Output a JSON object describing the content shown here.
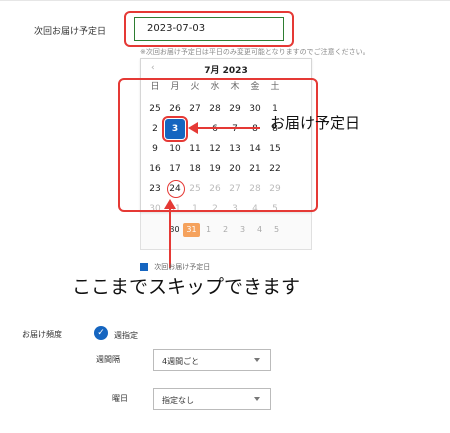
{
  "form": {
    "next_delivery_label": "次回お届け予定日",
    "date_value": "2023-07-03",
    "note": "※次回お届け予定日は平日のみ変更可能となりますのでご注意ください。",
    "frequency_label": "お届け頻度",
    "frequency_option": "週指定",
    "interval_label": "週間隔",
    "interval_value": "4週間ごと",
    "weekday_label": "曜日",
    "weekday_value": "指定なし",
    "hidden_checkbox_label": "次回お届け予定日"
  },
  "calendar": {
    "month_title": "7月 2023",
    "prev_icon": "‹",
    "weekdays": [
      "日",
      "月",
      "火",
      "水",
      "木",
      "金",
      "土"
    ],
    "rows": [
      [
        {
          "d": "25",
          "dim": false
        },
        {
          "d": "26",
          "dim": false
        },
        {
          "d": "27",
          "dim": false
        },
        {
          "d": "28",
          "dim": false
        },
        {
          "d": "29",
          "dim": false
        },
        {
          "d": "30",
          "dim": false
        },
        {
          "d": "1",
          "dim": false
        }
      ],
      [
        {
          "d": "2",
          "dim": false
        },
        {
          "d": "3",
          "dim": false,
          "sel": true
        },
        {
          "d": "4",
          "dim": false
        },
        {
          "d": "6",
          "dim": false
        },
        {
          "d": "7",
          "dim": false
        },
        {
          "d": "8",
          "dim": false
        },
        {
          "d": "8",
          "dim": false
        }
      ],
      [
        {
          "d": "9",
          "dim": false
        },
        {
          "d": "10",
          "dim": false
        },
        {
          "d": "11",
          "dim": false
        },
        {
          "d": "12",
          "dim": false
        },
        {
          "d": "13",
          "dim": false
        },
        {
          "d": "14",
          "dim": false
        },
        {
          "d": "15",
          "dim": false
        }
      ],
      [
        {
          "d": "16",
          "dim": false
        },
        {
          "d": "17",
          "dim": false
        },
        {
          "d": "18",
          "dim": false
        },
        {
          "d": "19",
          "dim": false
        },
        {
          "d": "20",
          "dim": false
        },
        {
          "d": "21",
          "dim": false
        },
        {
          "d": "22",
          "dim": false
        }
      ],
      [
        {
          "d": "23",
          "dim": false
        },
        {
          "d": "24",
          "dim": false,
          "ring": true
        },
        {
          "d": "25",
          "dim": true
        },
        {
          "d": "26",
          "dim": true
        },
        {
          "d": "27",
          "dim": true
        },
        {
          "d": "28",
          "dim": true
        },
        {
          "d": "29",
          "dim": true
        }
      ],
      [
        {
          "d": "30",
          "dim": true
        },
        {
          "d": "31",
          "dim": true
        },
        {
          "d": "1",
          "dim": true
        },
        {
          "d": "2",
          "dim": true
        },
        {
          "d": "3",
          "dim": true
        },
        {
          "d": "4",
          "dim": true
        },
        {
          "d": "5",
          "dim": true
        }
      ]
    ],
    "back_right_col": [
      "8",
      "15",
      "22"
    ],
    "back_bottom_row": [
      {
        "d": "30",
        "cls": ""
      },
      {
        "d": "31",
        "cls": "sel31"
      },
      {
        "d": "1",
        "cls": "dim"
      },
      {
        "d": "2",
        "cls": "dim"
      },
      {
        "d": "3",
        "cls": "dim"
      },
      {
        "d": "4",
        "cls": "dim"
      },
      {
        "d": "5",
        "cls": "dim"
      }
    ]
  },
  "annotations": {
    "arrow_label": "お届け予定日",
    "skip_label": "ここまでスキップできます"
  },
  "icons": {
    "check": "✓"
  },
  "colors": {
    "accent_blue": "#1565c0",
    "highlight_red": "#e53935",
    "input_border_green": "#2e7d32",
    "orange_selected": "#f5a25d"
  }
}
